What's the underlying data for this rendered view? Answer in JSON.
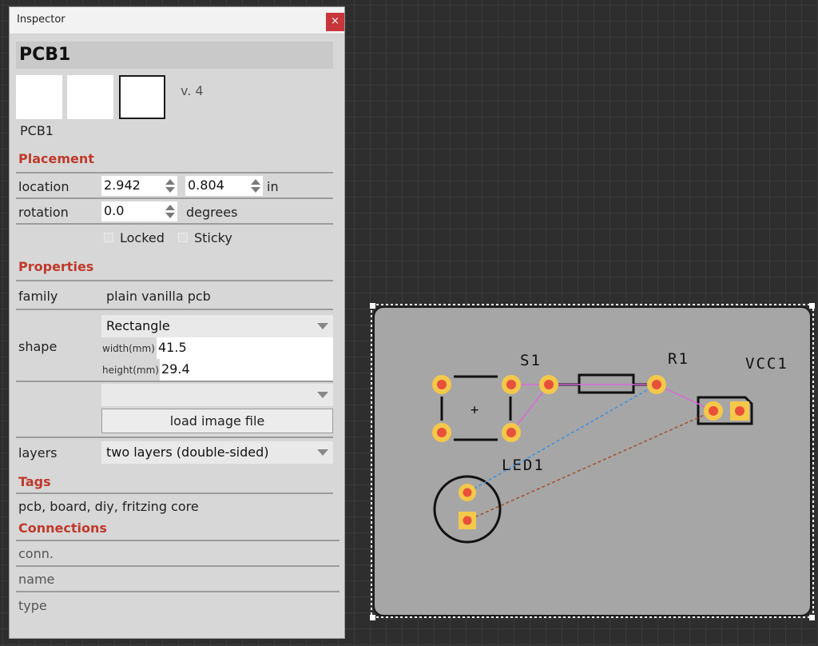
{
  "window": {
    "title": "Inspector",
    "close_symbol": "×"
  },
  "part": {
    "title": "PCB1",
    "version": "v. 4",
    "label": "PCB1"
  },
  "placement": {
    "header": "Placement",
    "location_label": "location",
    "location_x": "2.942",
    "location_y": "0.804",
    "location_unit": "in",
    "rotation_label": "rotation",
    "rotation_value": "0.0",
    "rotation_unit": "degrees",
    "locked_label": "Locked",
    "sticky_label": "Sticky",
    "locked": false,
    "sticky": false
  },
  "properties": {
    "header": "Properties",
    "family_label": "family",
    "family_value": "plain vanilla pcb",
    "shape_label": "shape",
    "shape_value": "Rectangle",
    "width_label": "width(mm)",
    "width_value": "41.5",
    "height_label": "height(mm)",
    "height_value": "29.4",
    "image_combo_value": "",
    "load_button": "load image file",
    "layers_label": "layers",
    "layers_value": "two layers (double-sided)"
  },
  "tags": {
    "header": "Tags",
    "value": "pcb, board, diy, fritzing core"
  },
  "connections": {
    "header": "Connections",
    "conn_label": "conn.",
    "name_label": "name",
    "type_label": "type"
  },
  "board": {
    "labels": {
      "s1": "S1",
      "r1": "R1",
      "vcc1": "VCC1",
      "led1": "LED1",
      "plus": "+"
    },
    "colors": {
      "board": "#a6a6a6",
      "pad_outer": "#f5c84a",
      "pad_inner": "#e8503a",
      "ratsnest_pink": "#d76ad8",
      "ratsnest_blue": "#3d8fe0",
      "ratsnest_brown": "#a0522d"
    }
  }
}
